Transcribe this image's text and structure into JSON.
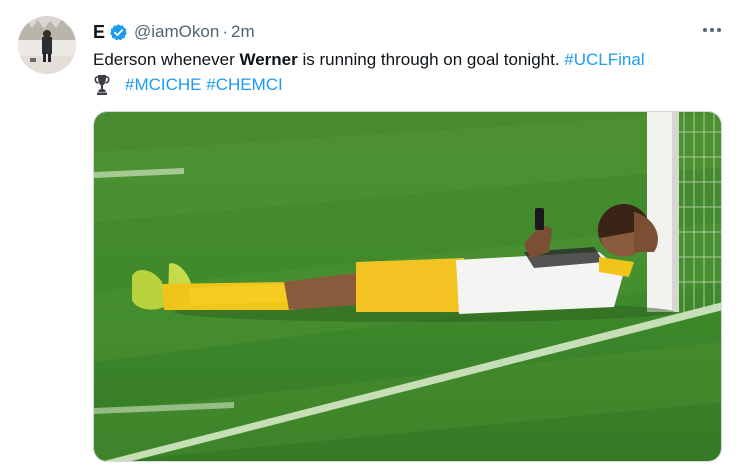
{
  "tweet": {
    "display_name": "E",
    "handle": "@iamOkon",
    "separator": "·",
    "time": "2m",
    "text": {
      "part1": "Ederson whenever ",
      "bold": "Werner",
      "part2": " is running through on goal tonight. ",
      "hashtag1": "#UCLFinal",
      "hashtag2": "#MCICHE",
      "hashtag3": "#CHEMCI"
    },
    "icons": {
      "verified": "verified-badge-icon",
      "more": "more-options-icon",
      "trophy": "trophy-icon"
    },
    "colors": {
      "accent": "#1d9bf0",
      "secondary_text": "#536471",
      "primary_text": "#0f1419"
    }
  }
}
